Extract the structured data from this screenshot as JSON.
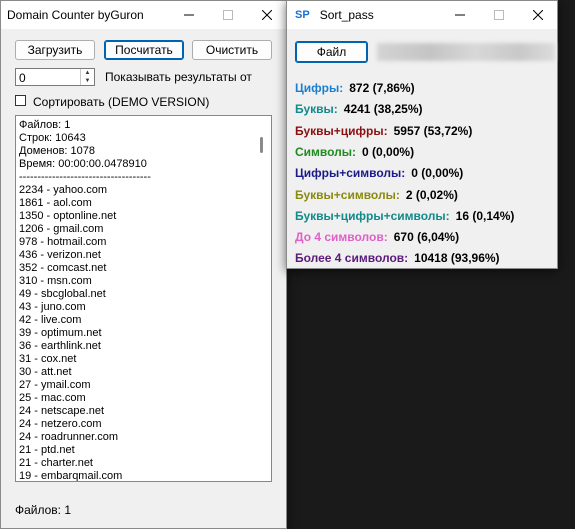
{
  "left_window": {
    "title": "Domain Counter byGuron",
    "buttons": {
      "load": "Загрузить",
      "count": "Посчитать",
      "clear": "Очистить"
    },
    "spin_value": "0",
    "show_results_label": "Показывать результаты от",
    "sort_label": "Сортировать (DEMO VERSION)",
    "results": [
      "Файлов: 1",
      "Строк: 10643",
      "Доменов: 1078",
      "Время: 00:00:00.0478910",
      "------------------------------------",
      "2234 - yahoo.com",
      "1861 - aol.com",
      "1350 - optonline.net",
      "1206 - gmail.com",
      "978 - hotmail.com",
      "436 - verizon.net",
      "352 - comcast.net",
      "310 - msn.com",
      "49 - sbcglobal.net",
      "43 - juno.com",
      "42 - live.com",
      "39 - optimum.net",
      "36 - earthlink.net",
      "31 - cox.net",
      "30 - att.net",
      "27 - ymail.com",
      "25 - mac.com",
      "24 - netscape.net",
      "24 - netzero.com",
      "24 - roadrunner.com",
      "21 - ptd.net",
      "21 - charter.net",
      "19 - embarqmail.com"
    ],
    "status": "Файлов: 1"
  },
  "right_window": {
    "title": "Sort_pass",
    "icon_text": "SP",
    "file_button": "Файл",
    "stats": [
      {
        "label": "Цифры:",
        "value": "872 (7,86%)",
        "color": "#1a7fd0"
      },
      {
        "label": "Буквы:",
        "value": "4241 (38,25%)",
        "color": "#128a8a"
      },
      {
        "label": "Буквы+цифры:",
        "value": "5957 (53,72%)",
        "color": "#8b1010"
      },
      {
        "label": "Символы:",
        "value": "0 (0,00%)",
        "color": "#1f8a1f"
      },
      {
        "label": "Цифры+символы:",
        "value": "0 (0,00%)",
        "color": "#1a1a8c"
      },
      {
        "label": "Буквы+символы:",
        "value": "2 (0,02%)",
        "color": "#8a8a10"
      },
      {
        "label": "Буквы+цифры+символы:",
        "value": "16 (0,14%)",
        "color": "#128a8a"
      },
      {
        "label": "До 4 символов:",
        "value": "670 (6,04%)",
        "color": "#e060c8"
      },
      {
        "label": "Более 4 символов:",
        "value": "10418 (93,96%)",
        "color": "#5a1a7a"
      }
    ]
  }
}
